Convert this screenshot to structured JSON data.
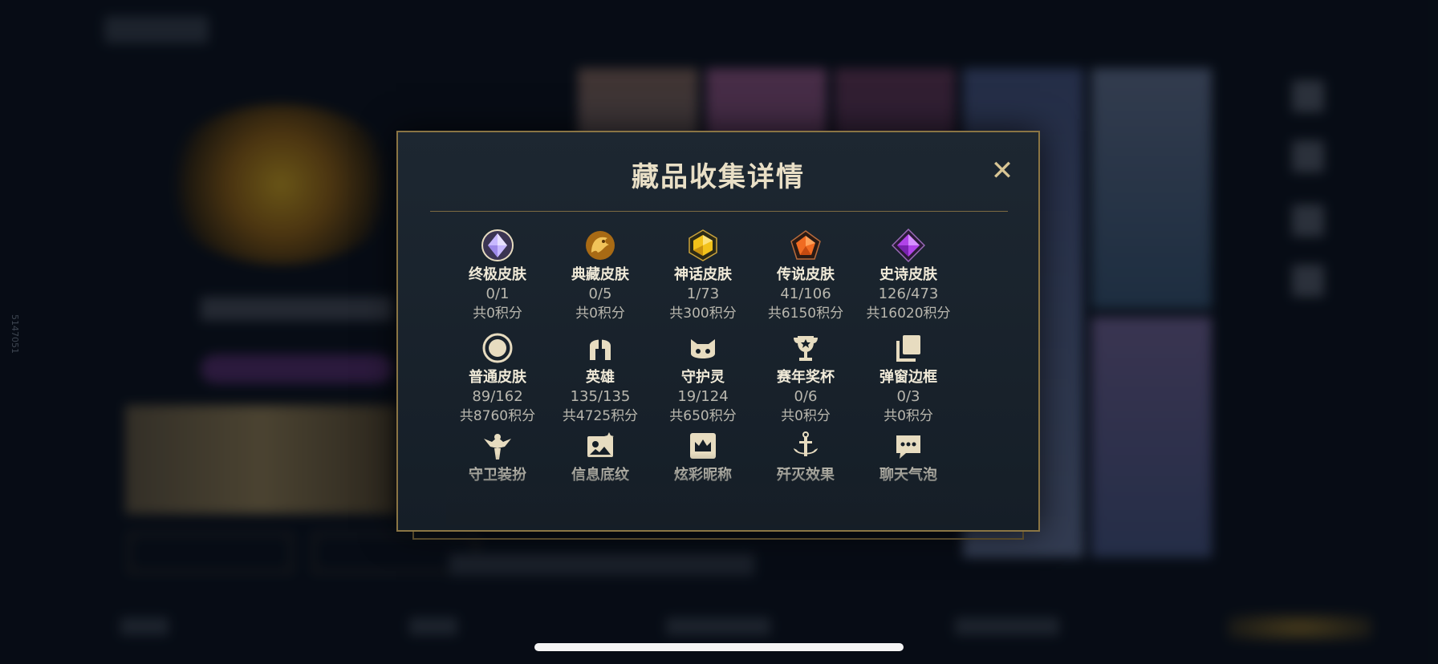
{
  "side_id": "5147051",
  "modal": {
    "title": "藏品收集详情",
    "close_symbol": "✕"
  },
  "categories": [
    {
      "name": "终极皮肤",
      "count": "0/1",
      "score": "共0积分",
      "icon": "ultimate-diamond-icon",
      "color": "#b9a7ff"
    },
    {
      "name": "典藏皮肤",
      "count": "0/5",
      "score": "共0积分",
      "icon": "dragon-icon",
      "color": "#e0a33a"
    },
    {
      "name": "神话皮肤",
      "count": "1/73",
      "score": "共300积分",
      "icon": "mythic-gem-icon",
      "color": "#f3c21a"
    },
    {
      "name": "传说皮肤",
      "count": "41/106",
      "score": "共6150积分",
      "icon": "legendary-gem-icon",
      "color": "#f06b22"
    },
    {
      "name": "史诗皮肤",
      "count": "126/473",
      "score": "共16020积分",
      "icon": "epic-gem-icon",
      "color": "#b043e8"
    },
    {
      "name": "普通皮肤",
      "count": "89/162",
      "score": "共8760积分",
      "icon": "circle-icon",
      "color": "#e7dcc0"
    },
    {
      "name": "英雄",
      "count": "135/135",
      "score": "共4725积分",
      "icon": "helmet-icon",
      "color": "#e7dcc0"
    },
    {
      "name": "守护灵",
      "count": "19/124",
      "score": "共650积分",
      "icon": "guardian-icon",
      "color": "#e7dcc0"
    },
    {
      "name": "赛年奖杯",
      "count": "0/6",
      "score": "共0积分",
      "icon": "trophy-icon",
      "color": "#e7dcc0"
    },
    {
      "name": "弹窗边框",
      "count": "0/3",
      "score": "共0积分",
      "icon": "frame-icon",
      "color": "#e7dcc0"
    },
    {
      "name": "守卫装扮",
      "count": "",
      "score": "",
      "icon": "ward-icon",
      "color": "#e7dcc0"
    },
    {
      "name": "信息底纹",
      "count": "",
      "score": "",
      "icon": "card-pattern-icon",
      "color": "#e7dcc0"
    },
    {
      "name": "炫彩昵称",
      "count": "",
      "score": "",
      "icon": "crown-nameplate-icon",
      "color": "#e7dcc0"
    },
    {
      "name": "歼灭效果",
      "count": "",
      "score": "",
      "icon": "anchor-icon",
      "color": "#e7dcc0"
    },
    {
      "name": "聊天气泡",
      "count": "",
      "score": "",
      "icon": "chat-bubble-icon",
      "color": "#e7dcc0"
    }
  ]
}
